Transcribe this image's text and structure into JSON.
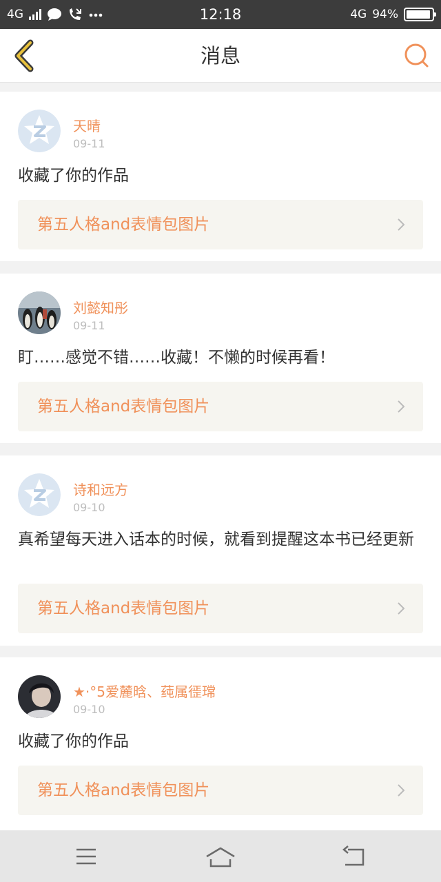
{
  "status": {
    "network_left": "4G",
    "time": "12:18",
    "network_right": "4G",
    "battery": "94%",
    "battery_level": 0.94
  },
  "header": {
    "title": "消息",
    "back_icon": "chevron-left-icon",
    "search_icon": "search-icon"
  },
  "messages": [
    {
      "name": "天晴",
      "date": "09-11",
      "text": "收藏了你的作品",
      "work": "第五人格and表情包图片",
      "avatar": "default-qq-avatar"
    },
    {
      "name": "刘懿知彤",
      "date": "09-11",
      "text": "盯……感觉不错……收藏！不懒的时候再看！",
      "work": "第五人格and表情包图片",
      "avatar": "penguins-photo-avatar"
    },
    {
      "name": "诗和远方",
      "date": "09-10",
      "text": "真希望每天进入话本的时候，就看到提醒这本书已经更新",
      "work": "第五人格and表情包图片",
      "avatar": "default-qq-avatar"
    },
    {
      "name": "★·°5爱麓晗、莼属徰瑺",
      "date": "09-10",
      "text": "收藏了你的作品",
      "work": "第五人格and表情包图片",
      "avatar": "person-photo-avatar"
    }
  ],
  "nav": {
    "menu_icon": "menu-icon",
    "home_icon": "home-icon",
    "back_icon": "back-icon"
  },
  "colors": {
    "accent": "#f0915a",
    "back_chevron": "#e8c13b",
    "status_bar": "#3c3c3c"
  }
}
